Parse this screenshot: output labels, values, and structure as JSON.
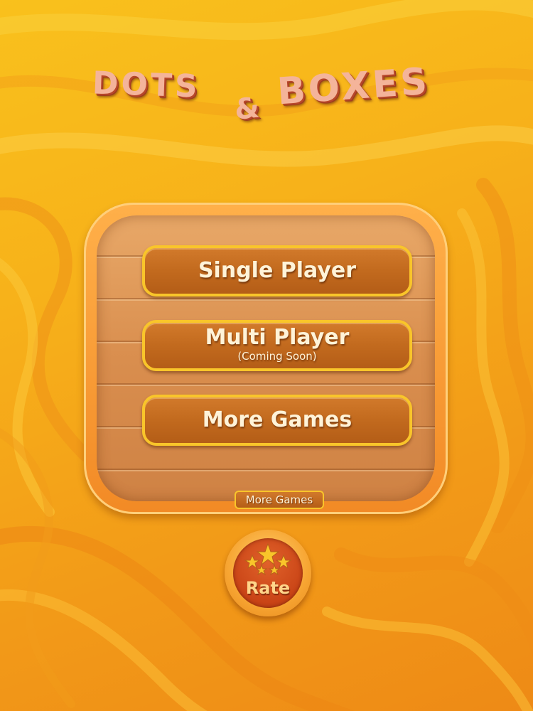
{
  "title": {
    "word1": "DOTS",
    "ampersand": "&",
    "word2": "BOXES"
  },
  "menu": {
    "single_player": "Single Player",
    "multi_player": "Multi Player",
    "multi_player_note": "(Coming Soon)",
    "more_games": "More Games",
    "more_games_small": "More Games"
  },
  "rate": {
    "label": "Rate",
    "icon": "stars-icon"
  },
  "colors": {
    "background": "#f7b11a",
    "panel": "#f28a25",
    "button_border": "#f9c52a",
    "button_fill": "#c26a1e",
    "rate_badge": "#c94416"
  }
}
